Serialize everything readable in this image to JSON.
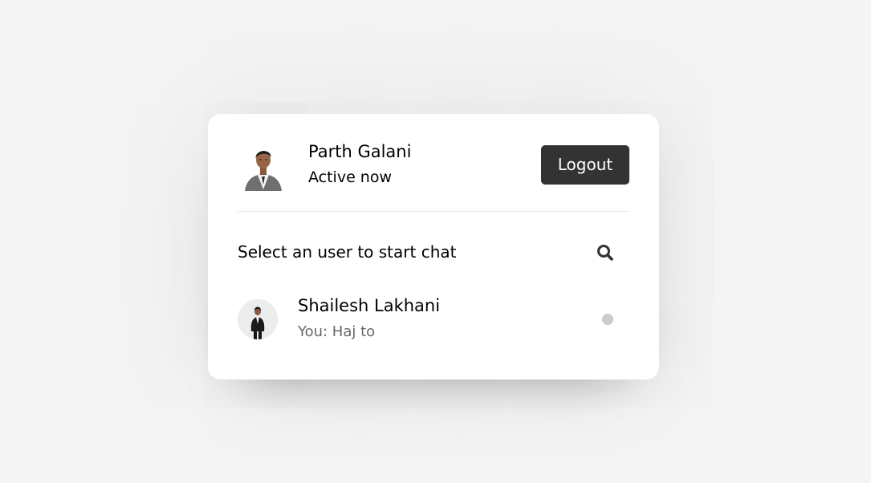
{
  "header": {
    "user_name": "Parth Galani",
    "status": "Active now",
    "logout_label": "Logout",
    "avatar_icon": "user-photo-icon"
  },
  "search": {
    "prompt": "Select an user to start chat",
    "icon": "search-icon"
  },
  "users": [
    {
      "name": "Shailesh Lakhani",
      "last_message": "You: Haj to",
      "status": "offline",
      "status_color": "#cccccc"
    }
  ],
  "colors": {
    "page_bg": "#f4f4f4",
    "card_bg": "#ffffff",
    "button_bg": "#333333",
    "muted_text": "#67676a"
  }
}
